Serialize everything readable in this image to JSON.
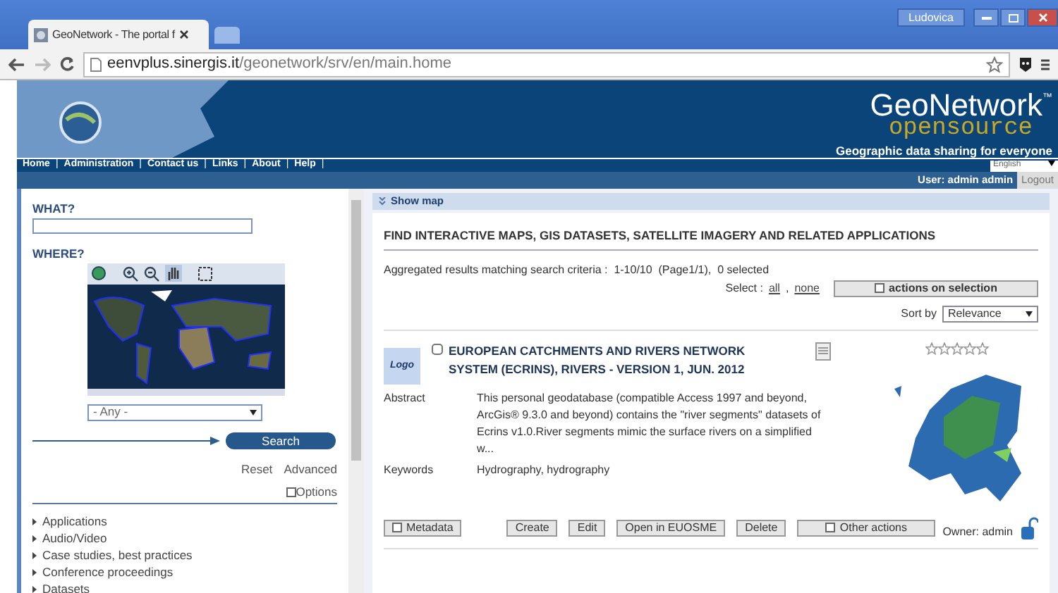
{
  "browser": {
    "tab_title": "GeoNetwork - The portal f",
    "user": "Ludovica",
    "url_host": "eenvplus.sinergis.it",
    "url_path": "/geonetwork/srv/en/main.home"
  },
  "banner": {
    "logo_primary": "GeoNetwork",
    "logo_secondary": "opensource",
    "trademark": "™",
    "tagline": "Geographic data sharing for everyone"
  },
  "nav_links": [
    "Home",
    "Administration",
    "Contact us",
    "Links",
    "About",
    "Help"
  ],
  "nav_separator": "|",
  "language": "English",
  "user_bar": {
    "user": "User: admin admin",
    "logout": "Logout"
  },
  "search": {
    "what_label": "WHAT?",
    "where_label": "WHERE?",
    "region": "- Any -",
    "search_button": "Search",
    "reset": "Reset",
    "advanced": "Advanced",
    "options": "Options"
  },
  "categories": [
    "Applications",
    "Audio/Video",
    "Case studies, best practices",
    "Conference proceedings",
    "Datasets"
  ],
  "results": {
    "show_map": "Show map",
    "heading": "FIND INTERACTIVE MAPS, GIS DATASETS, SATELLITE IMAGERY AND RELATED APPLICATIONS",
    "summary": "Aggregated results matching search criteria :  1-10/10  (Page1/1),  0 selected",
    "select_label": "Select :",
    "select_all": "all",
    "select_separator": ",",
    "select_none": "none",
    "actions_button": "actions on selection",
    "sort_label": "Sort by",
    "sort_value": "Relevance"
  },
  "record": {
    "logo": "Logo",
    "checked": false,
    "title": "EUROPEAN CATCHMENTS AND RIVERS NETWORK SYSTEM (ECRINS), RIVERS - VERSION 1, JUN. 2012",
    "stars": 0,
    "fields": [
      {
        "label": "Abstract",
        "value": "This personal geodatabase (compatible Access 1997 and beyond, ArcGis® 9.3.0 and beyond) contains the \"river segments\" datasets of Ecrins v1.0.River segments mimic the surface rivers on a simplified w..."
      },
      {
        "label": "Keywords",
        "value": "Hydrography, hydrography"
      }
    ],
    "buttons": [
      {
        "label": "Metadata",
        "kind": "expand"
      },
      {
        "label": "Create",
        "kind": "plain"
      },
      {
        "label": "Edit",
        "kind": "plain"
      },
      {
        "label": "Open in EUOSME",
        "kind": "plain"
      },
      {
        "label": "Delete",
        "kind": "plain"
      },
      {
        "label": "Other actions",
        "kind": "expand"
      }
    ],
    "owner": "Owner: admin"
  }
}
